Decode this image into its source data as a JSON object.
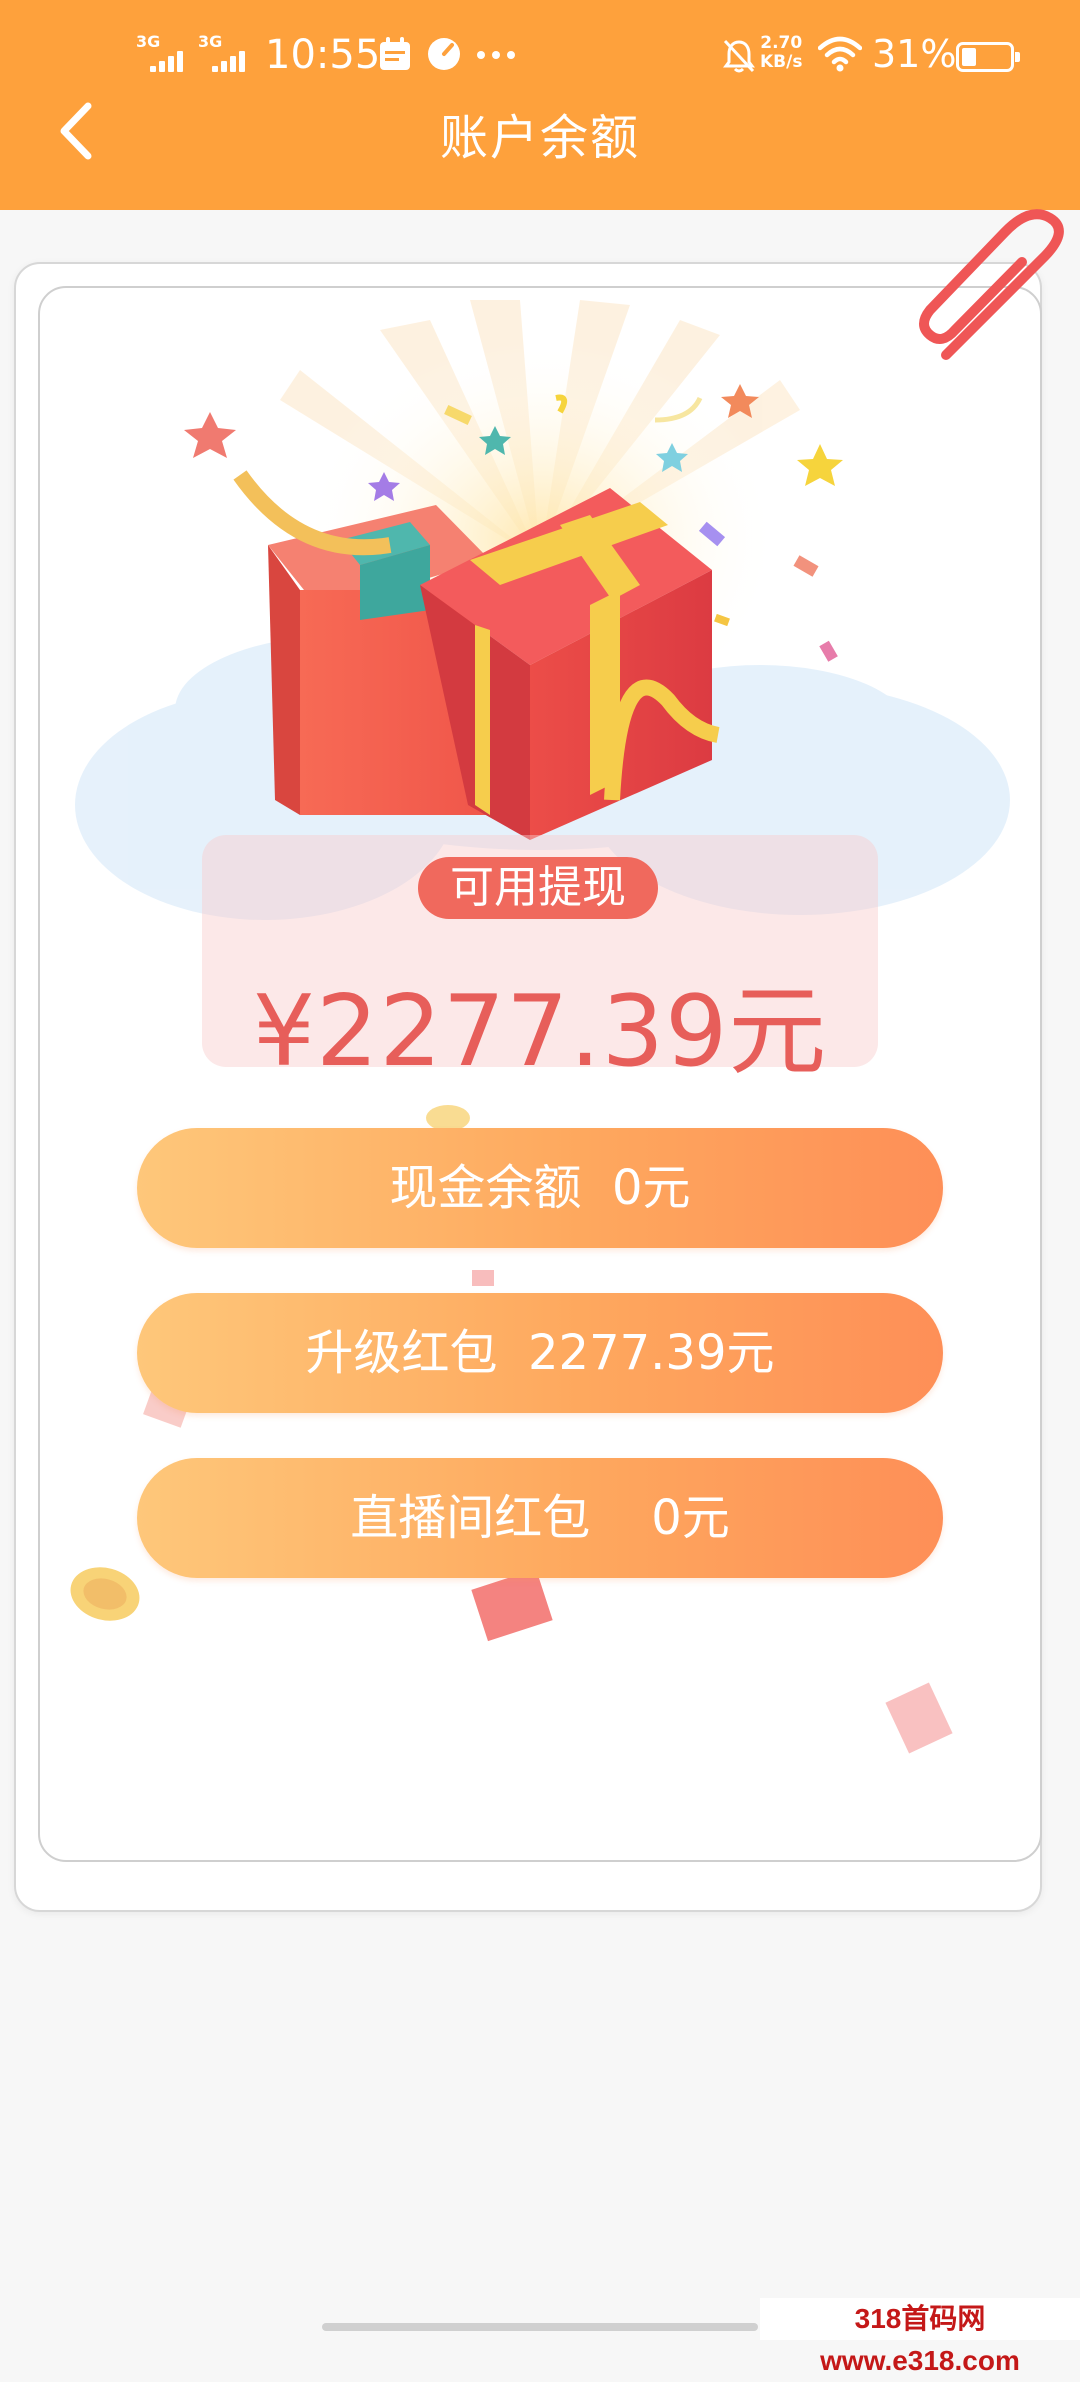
{
  "status_bar": {
    "sim1": "3G",
    "sim2": "3G",
    "time": "10:55",
    "net_speed_value": "2.70",
    "net_speed_unit": "KB/s",
    "battery": "31%",
    "battery_level": 0.31
  },
  "header": {
    "title": "账户余额",
    "background": "#fea13c"
  },
  "withdraw": {
    "label": "可用提现",
    "amount": "¥2277.39元"
  },
  "balances": [
    {
      "label": "现金余额  0元"
    },
    {
      "label": "升级红包  2277.39元"
    },
    {
      "label": "直播间红包    0元"
    }
  ],
  "watermark": "318首码网 www.e318.com",
  "colors": {
    "accent": "#fea13c",
    "amount": "#e75e5a",
    "label_badge": "#f0695d",
    "pill_start": "#fec77a",
    "pill_end": "#fe8f57"
  }
}
